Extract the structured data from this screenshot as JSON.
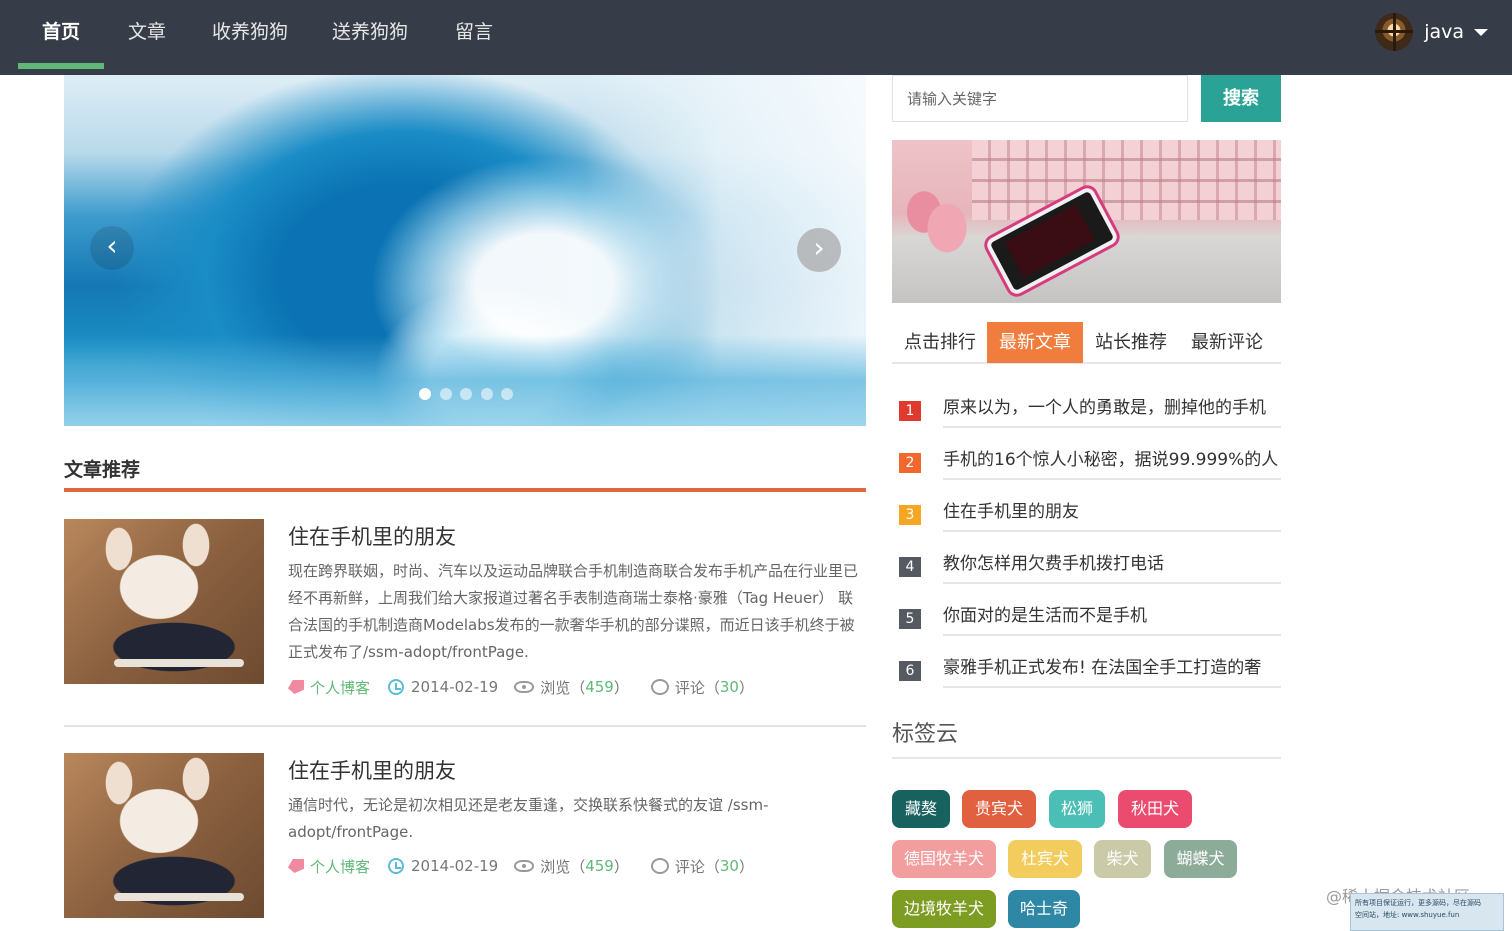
{
  "nav": {
    "items": [
      {
        "label": "首页",
        "active": true
      },
      {
        "label": "文章"
      },
      {
        "label": "收养狗狗"
      },
      {
        "label": "送养狗狗"
      },
      {
        "label": "留言"
      }
    ],
    "user": {
      "name": "java"
    },
    "colors": {
      "bg": "#373d48",
      "active_underline": "#5fb878"
    }
  },
  "carousel": {
    "prev_icon": "‹",
    "next_icon": "›",
    "slide_count": 5,
    "active_slide": 1
  },
  "recommend": {
    "title": "文章推荐",
    "articles": [
      {
        "title": "住在手机里的朋友",
        "desc": "现在跨界联姻，时尚、汽车以及运动品牌联合手机制造商联合发布手机产品在行业里已经不再新鲜，上周我们给大家报道过著名手表制造商瑞士泰格·豪雅（Tag Heuer） 联合法国的手机制造商Modelabs发布的一款奢华手机的部分谍照，而近日该手机终于被正式发布了/ssm-adopt/frontPage.",
        "category": "个人博客",
        "date": "2014-02-19",
        "views_label": "浏览（",
        "views": "459",
        "comments_label": "评论（",
        "comments": "30",
        "close_paren": "）"
      },
      {
        "title": "住在手机里的朋友",
        "desc": "通信时代，无论是初次相见还是老友重逢，交换联系快餐式的友谊 /ssm-adopt/frontPage.",
        "category": "个人博客",
        "date": "2014-02-19",
        "views_label": "浏览（",
        "views": "459",
        "comments_label": "评论（",
        "comments": "30",
        "close_paren": "）"
      }
    ]
  },
  "search": {
    "placeholder": "请输入关键字",
    "value": "",
    "button_label": "搜索"
  },
  "sidebar_tabs": {
    "items": [
      {
        "label": "点击排行"
      },
      {
        "label": "最新文章",
        "active": true
      },
      {
        "label": "站长推荐"
      },
      {
        "label": "最新评论"
      }
    ]
  },
  "ranking": {
    "items": [
      {
        "num": "1",
        "text": "原来以为，一个人的勇敢是，删掉他的手机",
        "color": "#e03a2f"
      },
      {
        "num": "2",
        "text": "手机的16个惊人小秘密，据说99.999%的人",
        "color": "#f0682e"
      },
      {
        "num": "3",
        "text": "住在手机里的朋友",
        "color": "#f5a623"
      },
      {
        "num": "4",
        "text": "教你怎样用欠费手机拨打电话",
        "color": "#555a60"
      },
      {
        "num": "5",
        "text": "你面对的是生活而不是手机",
        "color": "#555a60"
      },
      {
        "num": "6",
        "text": "豪雅手机正式发布! 在法国全手工打造的奢",
        "color": "#555a60"
      }
    ]
  },
  "tag_cloud": {
    "title": "标签云",
    "tags": [
      {
        "label": "藏獒",
        "color": "#17625f"
      },
      {
        "label": "贵宾犬",
        "color": "#e0603f"
      },
      {
        "label": "松狮",
        "color": "#4bbfb5"
      },
      {
        "label": "秋田犬",
        "color": "#ec4b70"
      },
      {
        "label": "德国牧羊犬",
        "color": "#f29e9e"
      },
      {
        "label": "杜宾犬",
        "color": "#f2cc5c"
      },
      {
        "label": "柴犬",
        "color": "#cbcaa8"
      },
      {
        "label": "蝴蝶犬",
        "color": "#8dab99"
      },
      {
        "label": "边境牧羊犬",
        "color": "#7d9d22"
      },
      {
        "label": "哈士奇",
        "color": "#2d87a5"
      }
    ]
  },
  "watermark": {
    "text": "@稀土掘金技术社区",
    "box_line1": "所有项目保证运行，更多源码，尽在源码",
    "box_line2": "空间站，地址: www.shuyue.fun"
  }
}
